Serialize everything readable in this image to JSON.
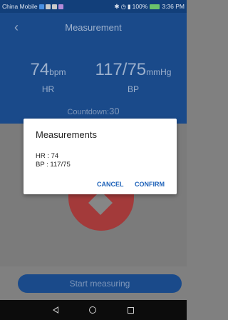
{
  "status_bar": {
    "carrier": "China Mobile",
    "battery_text": "100%",
    "time": "3:36 PM"
  },
  "header": {
    "title": "Measurement"
  },
  "readings": {
    "hr_value": "74",
    "hr_unit": "bpm",
    "hr_label": "HR",
    "bp_value": "117/75",
    "bp_unit": "mmHg",
    "bp_label": "BP",
    "countdown_label": "Countdown:",
    "countdown_value": "30"
  },
  "dialog": {
    "title": "Measurements",
    "hr_line": "HR : 74",
    "bp_line": "BP : 117/75",
    "cancel": "CANCEL",
    "confirm": "CONFIRM"
  },
  "buttons": {
    "start": "Start measuring"
  },
  "colors": {
    "primary": "#1a4a8a",
    "accent": "#1e62b9",
    "heart": "#a33a3a"
  }
}
